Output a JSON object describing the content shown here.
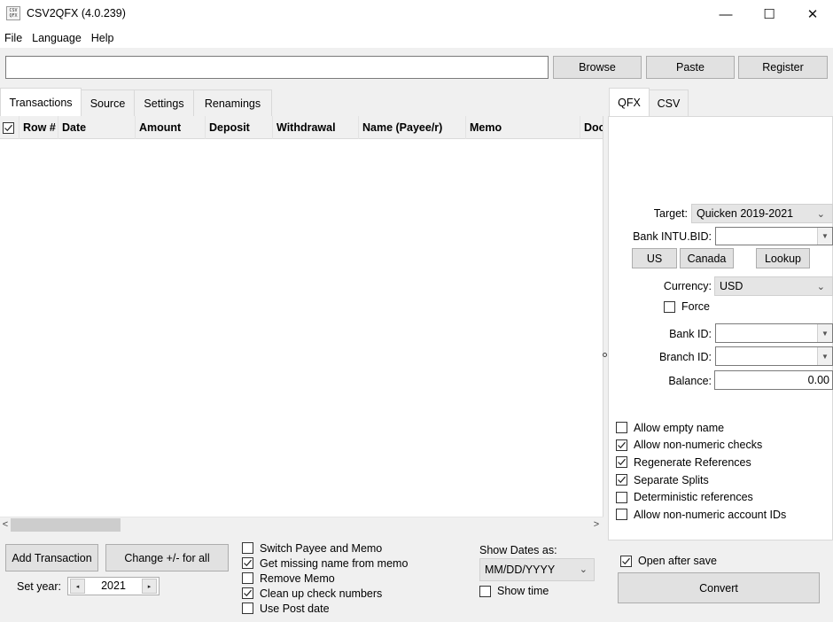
{
  "window": {
    "title": "CSV2QFX (4.0.239)",
    "icon_text": "CSV QFX",
    "controls": {
      "minimize": "—",
      "maximize": "☐",
      "close": "✕"
    }
  },
  "menu": [
    "File",
    "Language",
    "Help"
  ],
  "toolbar": {
    "path_value": "",
    "browse_label": "Browse",
    "paste_label": "Paste",
    "register_label": "Register"
  },
  "left_tabs": [
    {
      "label": "Transactions",
      "active": true
    },
    {
      "label": "Source",
      "active": false
    },
    {
      "label": "Settings",
      "active": false
    },
    {
      "label": "Renamings",
      "active": false
    }
  ],
  "table": {
    "select_all_checked": true,
    "columns": [
      "Row #",
      "Date",
      "Amount",
      "Deposit",
      "Withdrawal",
      "Name (Payee/r)",
      "Memo",
      "Doc"
    ],
    "rows": []
  },
  "scrollbar": {
    "left_arrow": "<",
    "right_arrow": ">"
  },
  "bottom": {
    "add_transaction_label": "Add Transaction",
    "change_sign_label": "Change +/- for all",
    "set_year_label": "Set year:",
    "year_value": "2021",
    "year_dec": "◂",
    "year_inc": "▸",
    "options": [
      {
        "label": "Switch Payee and Memo",
        "checked": false
      },
      {
        "label": "Get missing name from memo",
        "checked": true
      },
      {
        "label": "Remove Memo",
        "checked": false
      },
      {
        "label": "Clean up check numbers",
        "checked": true
      },
      {
        "label": "Use Post date",
        "checked": false
      }
    ],
    "show_dates_label": "Show Dates as:",
    "date_format": "MM/DD/YYYY",
    "show_time": {
      "label": "Show time",
      "checked": false
    }
  },
  "right_tabs": [
    {
      "label": "QFX",
      "active": true
    },
    {
      "label": "CSV",
      "active": false
    }
  ],
  "qfx": {
    "target_label": "Target:",
    "target_value": "Quicken 2019-2021",
    "bank_bid_label": "Bank INTU.BID:",
    "bank_bid_value": "",
    "us_label": "US",
    "canada_label": "Canada",
    "lookup_label": "Lookup",
    "currency_label": "Currency:",
    "currency_value": "USD",
    "force": {
      "label": "Force",
      "checked": false
    },
    "bank_id_label": "Bank ID:",
    "bank_id_value": "",
    "branch_id_label": "Branch ID:",
    "branch_id_value": "",
    "balance_label": "Balance:",
    "balance_value": "0.00",
    "options": [
      {
        "label": "Allow empty name",
        "checked": false
      },
      {
        "label": "Allow non-numeric checks",
        "checked": true
      },
      {
        "label": "Regenerate References",
        "checked": true
      },
      {
        "label": "Separate Splits",
        "checked": true
      },
      {
        "label": "Deterministic references",
        "checked": false
      },
      {
        "label": "Allow non-numeric account IDs",
        "checked": false
      }
    ]
  },
  "footer": {
    "open_after_save": {
      "label": "Open after save",
      "checked": true
    },
    "convert_label": "Convert"
  }
}
